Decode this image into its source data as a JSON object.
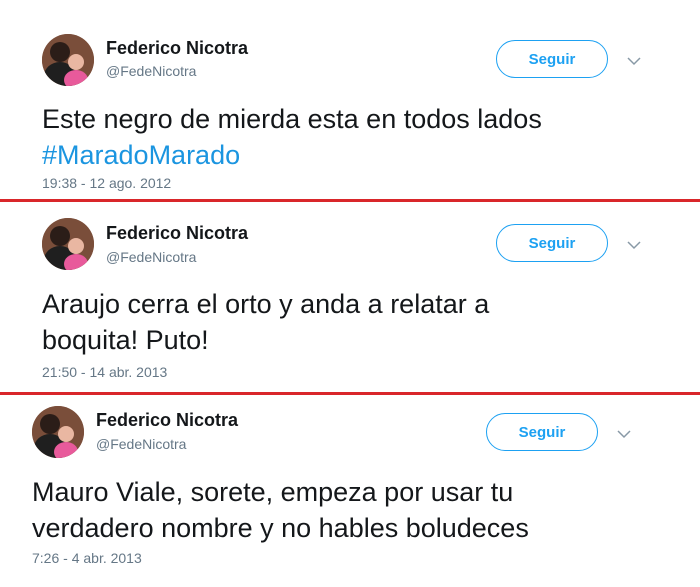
{
  "tweets": [
    {
      "author_name": "Federico Nicotra",
      "author_handle": "@FedeNicotra",
      "follow_label": "Seguir",
      "text_line1": "Este negro de mierda esta en todos lados",
      "hashtag": "#MaradoMarado",
      "timestamp": "19:38 - 12 ago. 2012",
      "avatar_icon": "profile-photo-icon",
      "menu_icon": "chevron-down-icon"
    },
    {
      "author_name": "Federico Nicotra",
      "author_handle": "@FedeNicotra",
      "follow_label": "Seguir",
      "text_line1": "Araujo cerra el orto y anda a relatar a",
      "text_line2": "boquita! Puto!",
      "timestamp": "21:50 - 14 abr. 2013",
      "avatar_icon": "profile-photo-icon",
      "menu_icon": "chevron-down-icon"
    },
    {
      "author_name": "Federico Nicotra",
      "author_handle": "@FedeNicotra",
      "follow_label": "Seguir",
      "text_line1": "Mauro Viale, sorete, empeza por usar tu",
      "text_line2": "verdadero nombre y no hables boludeces",
      "timestamp": "7:26 - 4 abr. 2013",
      "avatar_icon": "profile-photo-icon",
      "menu_icon": "chevron-down-icon"
    }
  ],
  "colors": {
    "accent": "#1da1f2",
    "hashtag": "#1b95e0",
    "divider": "#d9262a",
    "secondary_text": "#657786"
  }
}
